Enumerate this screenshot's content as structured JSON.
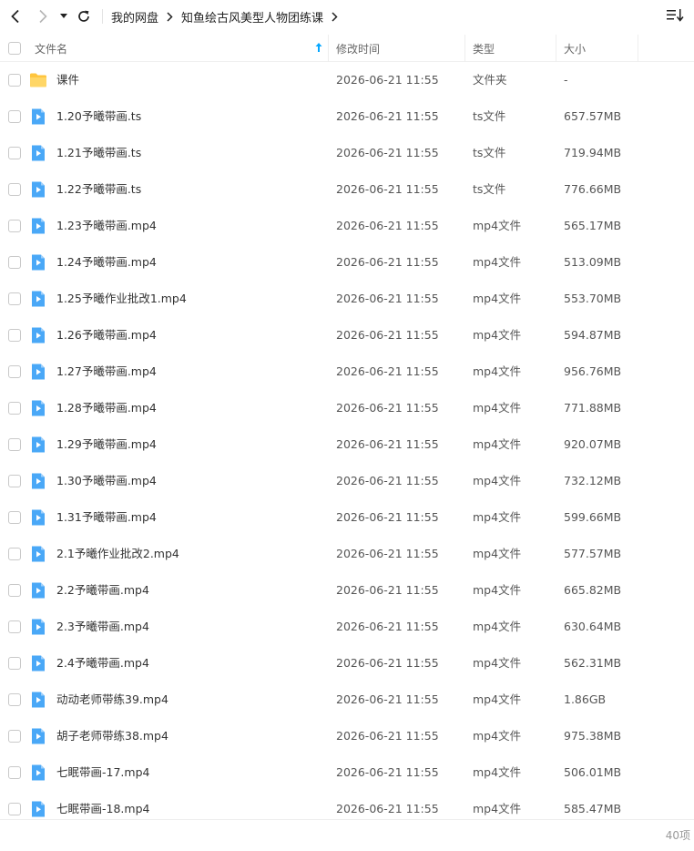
{
  "nav": {
    "breadcrumb": [
      "我的网盘",
      "知鱼绘古风美型人物团练课"
    ]
  },
  "header": {
    "name_label": "文件名",
    "date_label": "修改时间",
    "type_label": "类型",
    "size_label": "大小"
  },
  "files": [
    {
      "name": "课件",
      "date": "2026-06-21 11:55",
      "type": "文件夹",
      "size": "-",
      "icon": "folder-icon"
    },
    {
      "name": "1.20予曦带画.ts",
      "date": "2026-06-21 11:55",
      "type": "ts文件",
      "size": "657.57MB",
      "icon": "video-file-icon"
    },
    {
      "name": "1.21予曦带画.ts",
      "date": "2026-06-21 11:55",
      "type": "ts文件",
      "size": "719.94MB",
      "icon": "video-file-icon"
    },
    {
      "name": "1.22予曦带画.ts",
      "date": "2026-06-21 11:55",
      "type": "ts文件",
      "size": "776.66MB",
      "icon": "video-file-icon"
    },
    {
      "name": "1.23予曦带画.mp4",
      "date": "2026-06-21 11:55",
      "type": "mp4文件",
      "size": "565.17MB",
      "icon": "video-file-icon"
    },
    {
      "name": "1.24予曦带画.mp4",
      "date": "2026-06-21 11:55",
      "type": "mp4文件",
      "size": "513.09MB",
      "icon": "video-file-icon"
    },
    {
      "name": "1.25予曦作业批改1.mp4",
      "date": "2026-06-21 11:55",
      "type": "mp4文件",
      "size": "553.70MB",
      "icon": "video-file-icon"
    },
    {
      "name": "1.26予曦带画.mp4",
      "date": "2026-06-21 11:55",
      "type": "mp4文件",
      "size": "594.87MB",
      "icon": "video-file-icon"
    },
    {
      "name": "1.27予曦带画.mp4",
      "date": "2026-06-21 11:55",
      "type": "mp4文件",
      "size": "956.76MB",
      "icon": "video-file-icon"
    },
    {
      "name": "1.28予曦带画.mp4",
      "date": "2026-06-21 11:55",
      "type": "mp4文件",
      "size": "771.88MB",
      "icon": "video-file-icon"
    },
    {
      "name": "1.29予曦带画.mp4",
      "date": "2026-06-21 11:55",
      "type": "mp4文件",
      "size": "920.07MB",
      "icon": "video-file-icon"
    },
    {
      "name": "1.30予曦带画.mp4",
      "date": "2026-06-21 11:55",
      "type": "mp4文件",
      "size": "732.12MB",
      "icon": "video-file-icon"
    },
    {
      "name": "1.31予曦带画.mp4",
      "date": "2026-06-21 11:55",
      "type": "mp4文件",
      "size": "599.66MB",
      "icon": "video-file-icon"
    },
    {
      "name": "2.1予曦作业批改2.mp4",
      "date": "2026-06-21 11:55",
      "type": "mp4文件",
      "size": "577.57MB",
      "icon": "video-file-icon"
    },
    {
      "name": "2.2予曦带画.mp4",
      "date": "2026-06-21 11:55",
      "type": "mp4文件",
      "size": "665.82MB",
      "icon": "video-file-icon"
    },
    {
      "name": "2.3予曦带画.mp4",
      "date": "2026-06-21 11:55",
      "type": "mp4文件",
      "size": "630.64MB",
      "icon": "video-file-icon"
    },
    {
      "name": "2.4予曦带画.mp4",
      "date": "2026-06-21 11:55",
      "type": "mp4文件",
      "size": "562.31MB",
      "icon": "video-file-icon"
    },
    {
      "name": "动动老师带练39.mp4",
      "date": "2026-06-21 11:55",
      "type": "mp4文件",
      "size": "1.86GB",
      "icon": "video-file-icon"
    },
    {
      "name": "胡子老师带练38.mp4",
      "date": "2026-06-21 11:55",
      "type": "mp4文件",
      "size": "975.38MB",
      "icon": "video-file-icon"
    },
    {
      "name": "七眠带画-17.mp4",
      "date": "2026-06-21 11:55",
      "type": "mp4文件",
      "size": "506.01MB",
      "icon": "video-file-icon"
    },
    {
      "name": "七眠带画-18.mp4",
      "date": "2026-06-21 11:55",
      "type": "mp4文件",
      "size": "585.47MB",
      "icon": "video-file-icon"
    }
  ],
  "footer": {
    "count_label": "40项"
  },
  "colors": {
    "accent": "#06a7ff",
    "folder": "#ffc53d",
    "video": "#4aa8f7"
  }
}
